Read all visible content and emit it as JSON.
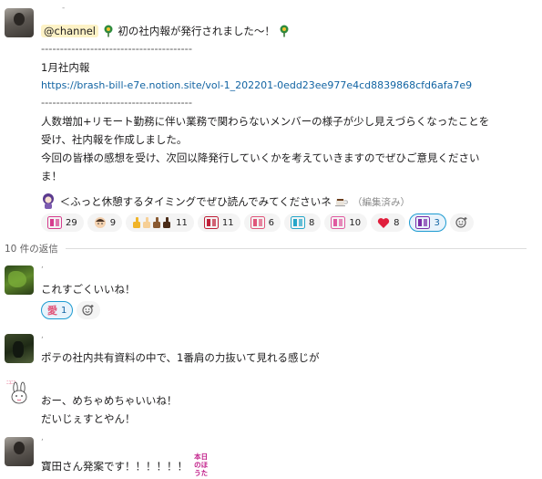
{
  "message1": {
    "mention": "@channel",
    "announce": "初の社内報が発行されました〜！",
    "separator1": "----------------------------------------",
    "title": "1月社内報",
    "link": "https://brash-bill-e7e.notion.site/vol-1_202201-0edd23ee977e4cd8839868cfd6afa7e9",
    "separator2": "----------------------------------------",
    "body1": "人数増加+リモート勤務に伴い業務で関わらないメンバーの様子が少し見えづらくなったことを",
    "body2": "受け、社内報を作成しました。",
    "body3": "今回の皆様の感想を受け、次回以降発行していくかを考えていきますのでぜひご意見ください",
    "body4": "ま！",
    "note": "＜ふっと休憩するタイミングでぜひ読んでみてくださいネ",
    "edited": "（編集済み）",
    "reactions": [
      {
        "icon": "stamp-icon",
        "count": "29",
        "color": "#d63d8e"
      },
      {
        "icon": "face-icon",
        "count": "9",
        "color": "#b08060"
      },
      {
        "icon": "thumbs-up-icon",
        "count": "11",
        "color": "#f0b429"
      },
      {
        "icon": "stamp-icon",
        "count": "11",
        "color": "#c0223a"
      },
      {
        "icon": "stamp-icon",
        "count": "6",
        "color": "#e0567a"
      },
      {
        "icon": "stamp-icon",
        "count": "8",
        "color": "#26a6c9"
      },
      {
        "icon": "stamp-icon",
        "count": "10",
        "color": "#e05aa0"
      },
      {
        "icon": "heart-icon",
        "count": "8",
        "color": "#e01e3c"
      },
      {
        "icon": "stamp-icon",
        "count": "3",
        "color": "#7b2ea8",
        "selected": true
      }
    ]
  },
  "replies_label": "10 件の返信",
  "reply1": {
    "text": "これすごくいいね！",
    "reaction_icon": "愛",
    "reaction_count": "1"
  },
  "reply2": {
    "text": "ポテの社内共有資料の中で、1番肩の力抜いて見れる感じが"
  },
  "reply3": {
    "line1": "おー、めちゃめちゃいいね！",
    "line2": "だいじぇすとやん！"
  },
  "reply4": {
    "text": "寶田さん発案です！！！！！！",
    "stamp_text": "本日のほうた"
  }
}
